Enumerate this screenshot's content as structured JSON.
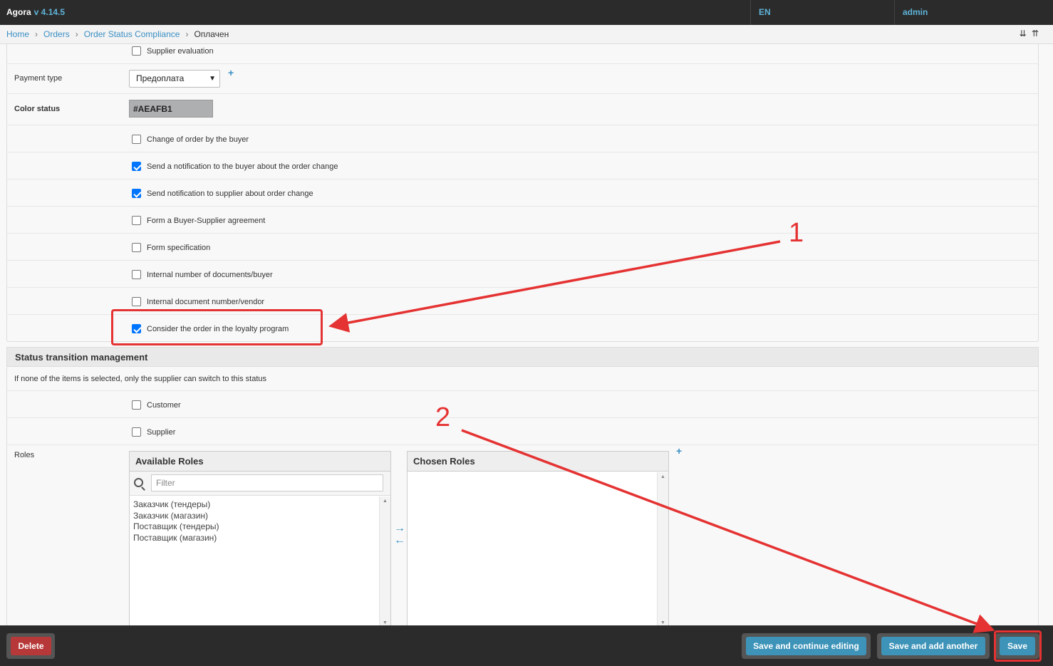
{
  "header": {
    "brand": "Agora",
    "version": "v 4.14.5",
    "language": "EN",
    "user": "admin"
  },
  "breadcrumbs": {
    "items": [
      "Home",
      "Orders",
      "Order Status Compliance"
    ],
    "current": "Оплачен",
    "separator": "›",
    "collapse_icons": "⇊ ⇈"
  },
  "form": {
    "supplier_evaluation": {
      "label": "Supplier evaluation",
      "checked": false
    },
    "payment_type": {
      "label": "Payment type",
      "value": "Предоплата",
      "add": "+"
    },
    "color_status": {
      "label": "Color status",
      "value": "#AEAFB1"
    },
    "checkboxes": [
      {
        "label": "Change of order by the buyer",
        "checked": false
      },
      {
        "label": "Send a notification to the buyer about the order change",
        "checked": true
      },
      {
        "label": "Send notification to supplier about order change",
        "checked": true
      },
      {
        "label": "Form a Buyer-Supplier agreement",
        "checked": false
      },
      {
        "label": "Form specification",
        "checked": false
      },
      {
        "label": "Internal number of documents/buyer",
        "checked": false
      },
      {
        "label": "Internal document number/vendor",
        "checked": false
      },
      {
        "label": "Consider the order in the loyalty program",
        "checked": true
      }
    ]
  },
  "transitions": {
    "title": "Status transition management",
    "help": "If none of the items is selected, only the supplier can switch to this status",
    "customer": {
      "label": "Customer",
      "checked": false
    },
    "supplier": {
      "label": "Supplier",
      "checked": false
    },
    "roles": {
      "label": "Roles",
      "available_title": "Available Roles",
      "chosen_title": "Chosen Roles",
      "filter_placeholder": "Filter",
      "available": [
        "Заказчик (тендеры)",
        "Заказчик (магазин)",
        "Поставщик (тендеры)",
        "Поставщик (магазин)"
      ],
      "chosen": [],
      "add": "+",
      "move_right": "→",
      "move_left": "←"
    }
  },
  "footer": {
    "delete": "Delete",
    "save_continue": "Save and continue editing",
    "save_add": "Save and add another",
    "save": "Save"
  },
  "annotations": {
    "one": "1",
    "two": "2",
    "color": "#e53232"
  },
  "colors": {
    "header_bg": "#2b2b2b",
    "link": "#3a8fc4",
    "button_blue": "#3d93b8",
    "button_red": "#b73838",
    "checkbox": "#0075ff"
  }
}
